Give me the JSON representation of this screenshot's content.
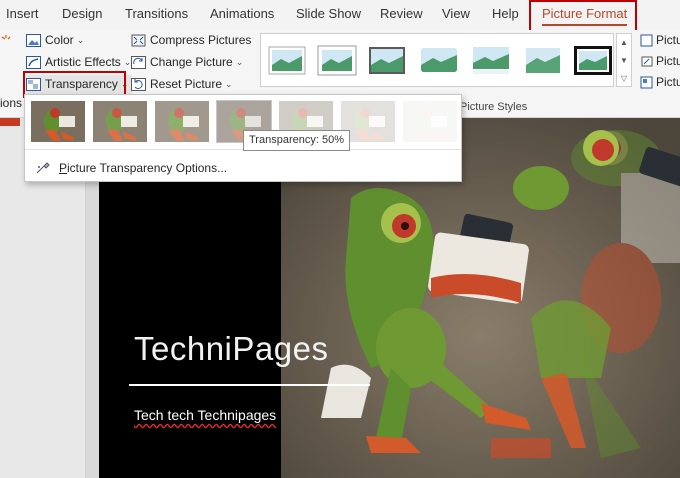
{
  "menu": {
    "tabs": [
      "Insert",
      "Design",
      "Transitions",
      "Animations",
      "Slide Show",
      "Review",
      "View",
      "Help"
    ],
    "active_tab": "Picture Format"
  },
  "ribbon": {
    "cutoff_label": "ions",
    "color": "Color",
    "artistic_effects": "Artistic Effects",
    "transparency": "Transparency",
    "compress": "Compress Pictures",
    "change": "Change Picture",
    "reset": "Reset Picture",
    "group_label": "Picture Styles",
    "right_1": "Pictu",
    "right_2": "Pictu",
    "right_3": "Pictu"
  },
  "dropdown": {
    "presets": [
      "0%",
      "15%",
      "30%",
      "50%",
      "65%",
      "80%",
      "95%"
    ],
    "option_first": "P",
    "option_rest": "icture Transparency Options...",
    "tooltip": "Transparency: 50%"
  },
  "slide": {
    "title": "TechniPages",
    "subtitle": "Tech tech Technipages"
  },
  "colors": {
    "accent": "#b7472a",
    "highlight": "#c00000"
  }
}
